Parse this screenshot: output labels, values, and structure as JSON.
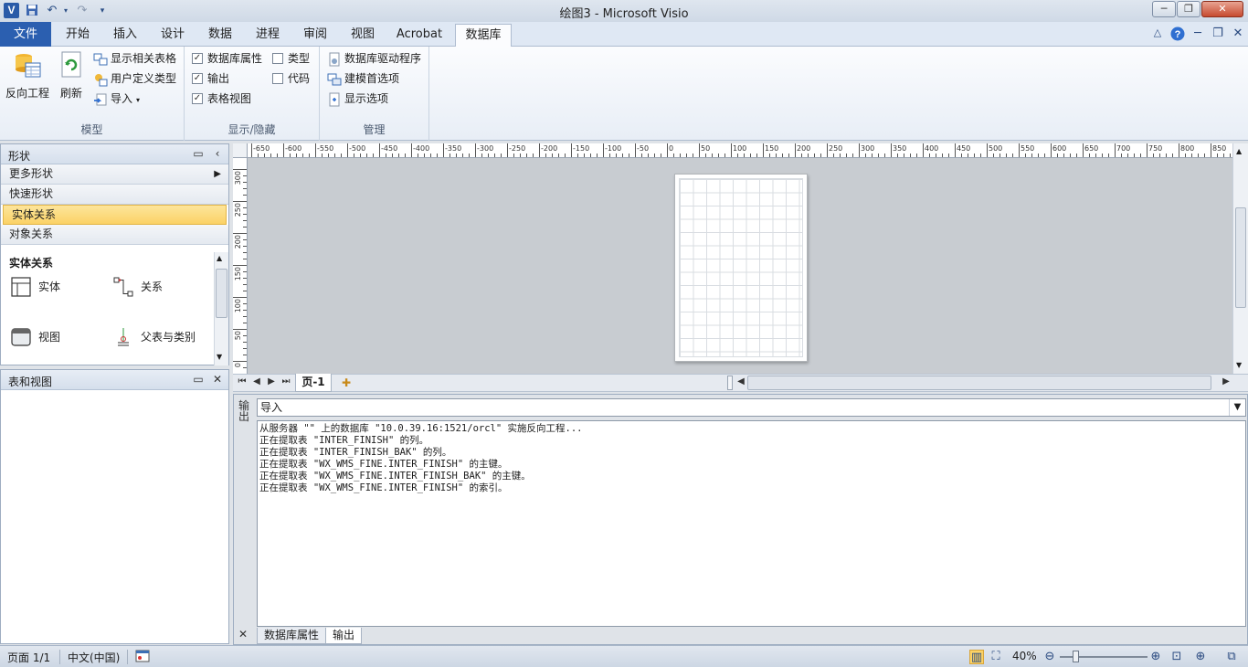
{
  "window": {
    "title": "绘图3  -  Microsoft Visio",
    "app_icon": "V",
    "qat": [
      "save-icon",
      "undo-icon",
      "redo-icon",
      "customize-qat-icon"
    ]
  },
  "ribbon": {
    "tabs": [
      {
        "label": "文件"
      },
      {
        "label": "开始"
      },
      {
        "label": "插入"
      },
      {
        "label": "设计"
      },
      {
        "label": "数据"
      },
      {
        "label": "进程"
      },
      {
        "label": "审阅"
      },
      {
        "label": "视图"
      },
      {
        "label": "Acrobat"
      },
      {
        "label": "数据库"
      }
    ],
    "active_tab": "数据库",
    "model_group": {
      "label": "模型",
      "reverse_engineer": "反向工程",
      "refresh": "刷新",
      "show_related_tables": "显示相关表格",
      "user_defined_types": "用户定义类型",
      "import": "导入"
    },
    "showhide_group": {
      "label": "显示/隐藏",
      "db_properties": "数据库属性",
      "output": "输出",
      "tables_views": "表格视图",
      "types": "类型",
      "code": "代码"
    },
    "manage_group": {
      "label": "管理",
      "drivers": "数据库驱动程序",
      "modeling_prefs": "建模首选项",
      "display_options": "显示选项"
    }
  },
  "shapes_pane": {
    "title": "形状",
    "stencils": [
      "更多形状",
      "快速形状",
      "实体关系",
      "对象关系"
    ],
    "selected_stencil": "实体关系",
    "stencil_header": "实体关系",
    "masters": [
      "实体",
      "关系",
      "视图",
      "父表与类别"
    ]
  },
  "tables_pane": {
    "title": "表和视图"
  },
  "ruler": {
    "x_ticks": [
      "-650",
      "-600",
      "-550",
      "-500",
      "-450",
      "-400",
      "-350",
      "-300",
      "-250",
      "-200",
      "-150",
      "-100",
      "-50",
      "0",
      "50",
      "100",
      "150",
      "200",
      "250",
      "300",
      "350",
      "400",
      "450",
      "500",
      "550",
      "600",
      "650",
      "700",
      "750",
      "800",
      "850"
    ],
    "y_ticks": [
      "300",
      "250",
      "200",
      "150",
      "100",
      "50",
      "0"
    ]
  },
  "page_tabs": {
    "current": "页-1"
  },
  "output_window": {
    "side_label": "输出",
    "source": "导入",
    "lines": [
      "从服务器 \"\" 上的数据库 \"10.0.39.16:1521/orcl\" 实施反向工程...",
      "正在提取表 \"INTER_FINISH\" 的列。",
      "正在提取表 \"INTER_FINISH_BAK\" 的列。",
      "正在提取表 \"WX_WMS_FINE.INTER_FINISH\" 的主键。",
      "正在提取表 \"WX_WMS_FINE.INTER_FINISH_BAK\" 的主键。",
      "正在提取表 \"WX_WMS_FINE.INTER_FINISH\" 的索引。"
    ],
    "bottom_tabs": [
      "数据库属性",
      "输出"
    ],
    "active_bottom_tab": "输出"
  },
  "status_bar": {
    "page": "页面 1/1",
    "language": "中文(中国)",
    "zoom": "40%"
  }
}
